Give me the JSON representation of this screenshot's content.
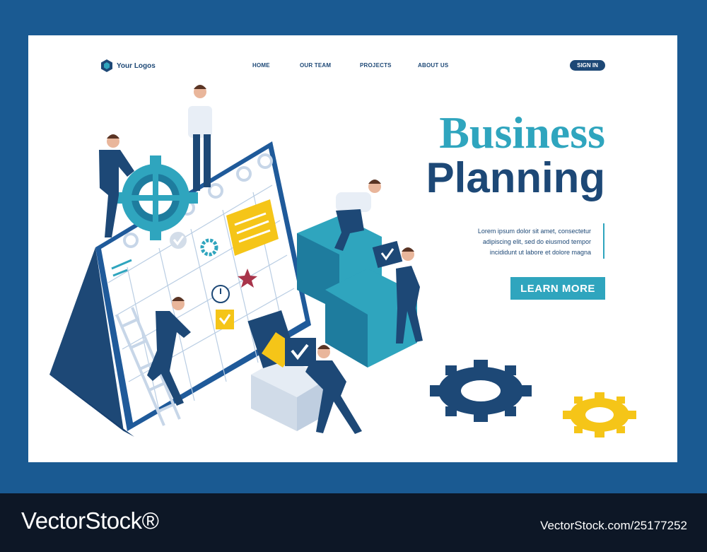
{
  "header": {
    "logo_text": "Your Logos",
    "nav": [
      "HOME",
      "OUR TEAM",
      "PROJECTS",
      "ABOUT US"
    ],
    "sign_in": "SIGN IN"
  },
  "hero": {
    "title_line1": "Business",
    "title_line2": "Planning",
    "description": [
      "Lorem ipsum dolor sit amet, consectetur",
      "adipiscing elit, sed do eiusmod tempor",
      "incididunt ut labore et dolore magna"
    ],
    "cta": "LEARN MORE"
  },
  "footer": {
    "brand": "VectorStock®",
    "image_id": "VectorStock.com/25177252"
  },
  "colors": {
    "frame": "#1a5a92",
    "navy": "#1d4876",
    "teal": "#2fa5be",
    "yellow": "#f5c518",
    "footer": "#0d1726"
  },
  "icons": [
    "logo-hexagon-icon",
    "gear-icon",
    "checkmark-icon",
    "clock-icon",
    "star-icon"
  ]
}
